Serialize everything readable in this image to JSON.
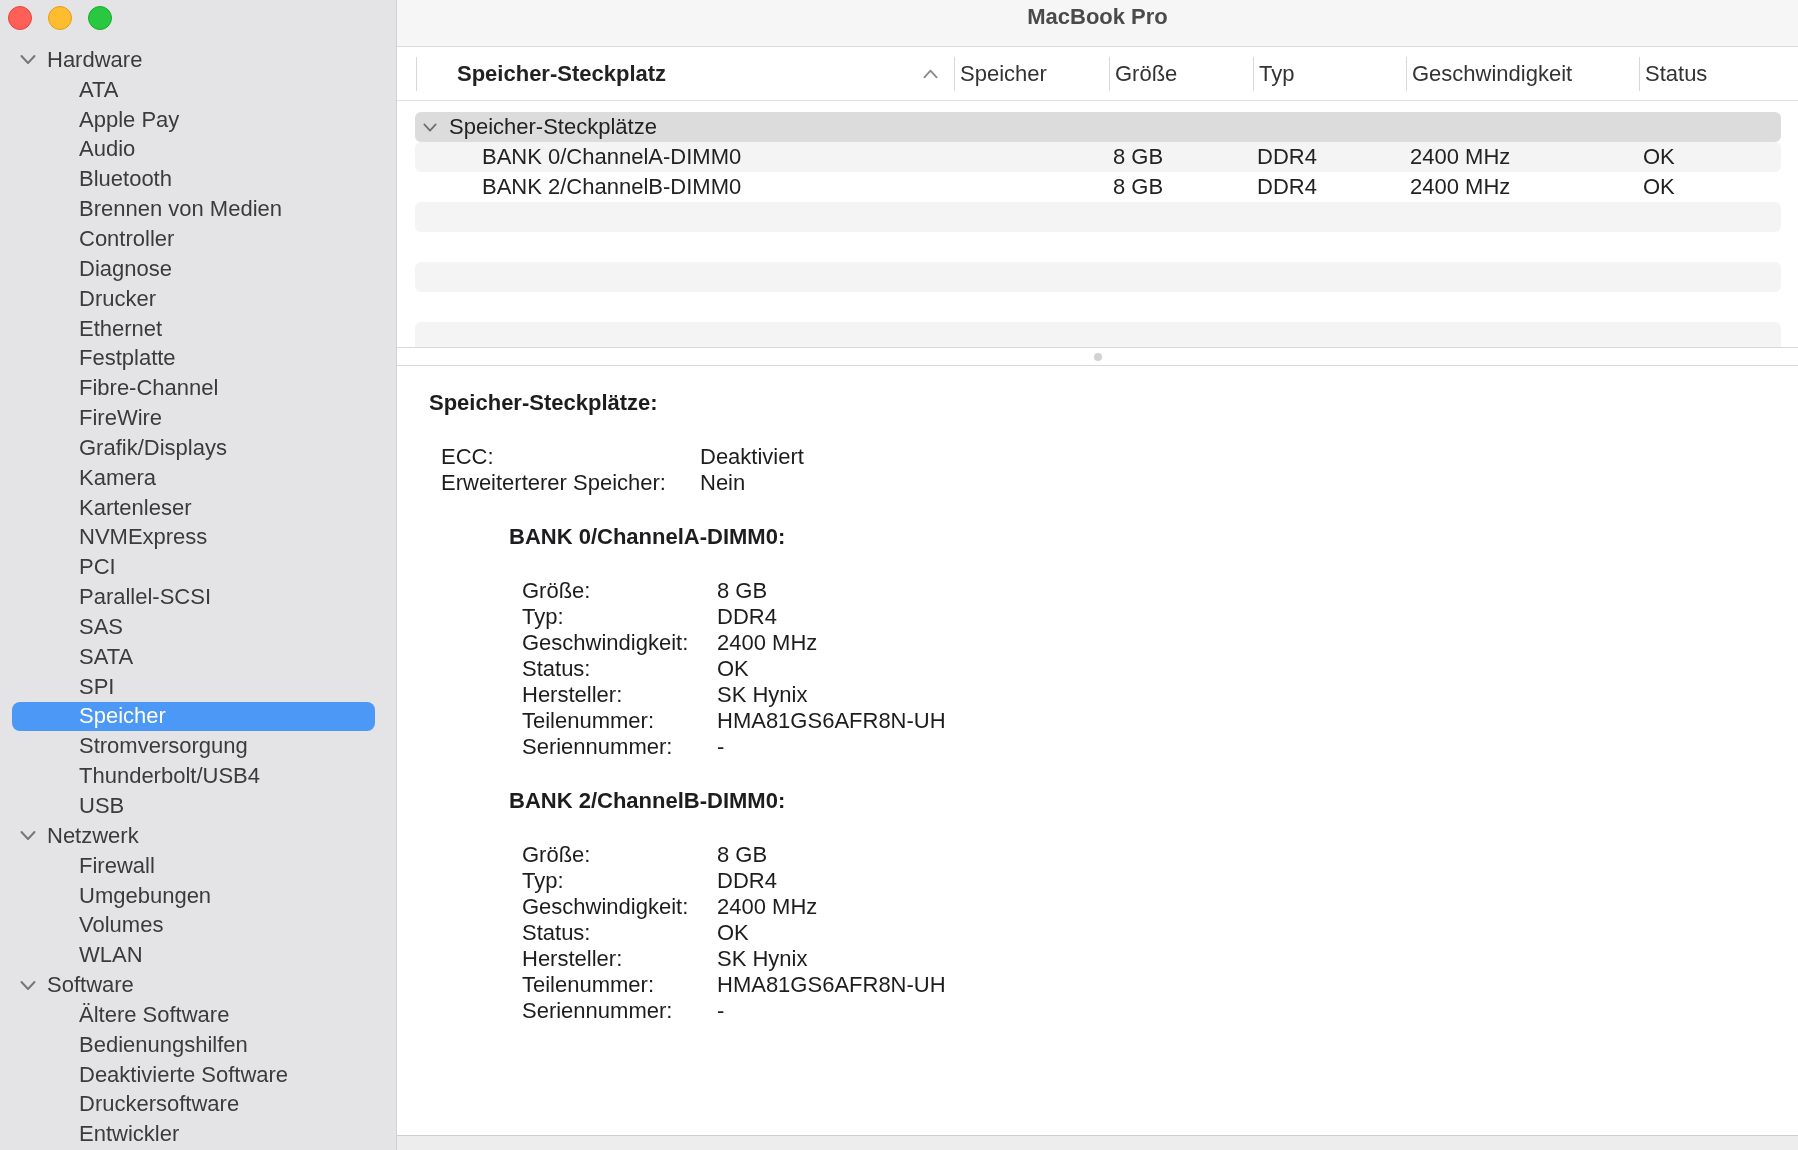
{
  "window": {
    "title": "MacBook Pro"
  },
  "sidebar": {
    "items": [
      {
        "label": "Hardware",
        "expanded": true,
        "selected": false,
        "children": [
          {
            "label": "ATA",
            "selected": false
          },
          {
            "label": "Apple Pay",
            "selected": false
          },
          {
            "label": "Audio",
            "selected": false
          },
          {
            "label": "Bluetooth",
            "selected": false
          },
          {
            "label": "Brennen von Medien",
            "selected": false
          },
          {
            "label": "Controller",
            "selected": false
          },
          {
            "label": "Diagnose",
            "selected": false
          },
          {
            "label": "Drucker",
            "selected": false
          },
          {
            "label": "Ethernet",
            "selected": false
          },
          {
            "label": "Festplatte",
            "selected": false
          },
          {
            "label": "Fibre-Channel",
            "selected": false
          },
          {
            "label": "FireWire",
            "selected": false
          },
          {
            "label": "Grafik/Displays",
            "selected": false
          },
          {
            "label": "Kamera",
            "selected": false
          },
          {
            "label": "Kartenleser",
            "selected": false
          },
          {
            "label": "NVMExpress",
            "selected": false
          },
          {
            "label": "PCI",
            "selected": false
          },
          {
            "label": "Parallel-SCSI",
            "selected": false
          },
          {
            "label": "SAS",
            "selected": false
          },
          {
            "label": "SATA",
            "selected": false
          },
          {
            "label": "SPI",
            "selected": false
          },
          {
            "label": "Speicher",
            "selected": true
          },
          {
            "label": "Stromversorgung",
            "selected": false
          },
          {
            "label": "Thunderbolt/USB4",
            "selected": false
          },
          {
            "label": "USB",
            "selected": false
          }
        ]
      },
      {
        "label": "Netzwerk",
        "expanded": true,
        "selected": false,
        "children": [
          {
            "label": "Firewall",
            "selected": false
          },
          {
            "label": "Umgebungen",
            "selected": false
          },
          {
            "label": "Volumes",
            "selected": false
          },
          {
            "label": "WLAN",
            "selected": false
          }
        ]
      },
      {
        "label": "Software",
        "expanded": true,
        "selected": false,
        "children": [
          {
            "label": "Ältere Software",
            "selected": false
          },
          {
            "label": "Bedienungshilfen",
            "selected": false
          },
          {
            "label": "Deaktivierte Software",
            "selected": false
          },
          {
            "label": "Druckersoftware",
            "selected": false
          },
          {
            "label": "Entwickler",
            "selected": false
          }
        ]
      }
    ]
  },
  "table": {
    "columns": [
      {
        "label": "Speicher-Steckplatz",
        "sorted": true
      },
      {
        "label": "Speicher",
        "sorted": false
      },
      {
        "label": "Größe",
        "sorted": false
      },
      {
        "label": "Typ",
        "sorted": false
      },
      {
        "label": "Geschwindigkeit",
        "sorted": false
      },
      {
        "label": "Status",
        "sorted": false
      }
    ],
    "rows": [
      {
        "slot": "Speicher-Steckplätze",
        "expanded": true,
        "selected": true,
        "children": [
          {
            "slot": "BANK 0/ChannelA-DIMM0",
            "size": "8 GB",
            "type": "DDR4",
            "speed": "2400 MHz",
            "status": "OK",
            "selected": false
          },
          {
            "slot": "BANK 2/ChannelB-DIMM0",
            "size": "8 GB",
            "type": "DDR4",
            "speed": "2400 MHz",
            "status": "OK",
            "selected": false
          }
        ]
      }
    ]
  },
  "detail": {
    "title": "Speicher-Steckplätze:",
    "properties": [
      {
        "label": "ECC:",
        "value": "Deaktiviert"
      },
      {
        "label": "Erweiterterer Speicher:",
        "value": "Nein"
      }
    ],
    "sections": [
      {
        "title": "BANK 0/ChannelA-DIMM0:",
        "properties": [
          {
            "label": "Größe:",
            "value": "8 GB"
          },
          {
            "label": "Typ:",
            "value": "DDR4"
          },
          {
            "label": "Geschwindigkeit:",
            "value": "2400 MHz"
          },
          {
            "label": "Status:",
            "value": "OK"
          },
          {
            "label": "Hersteller:",
            "value": "SK Hynix"
          },
          {
            "label": "Teilenummer:",
            "value": "HMA81GS6AFR8N-UH"
          },
          {
            "label": "Seriennummer:",
            "value": "-"
          }
        ]
      },
      {
        "title": "BANK 2/ChannelB-DIMM0:",
        "properties": [
          {
            "label": "Größe:",
            "value": "8 GB"
          },
          {
            "label": "Typ:",
            "value": "DDR4"
          },
          {
            "label": "Geschwindigkeit:",
            "value": "2400 MHz"
          },
          {
            "label": "Status:",
            "value": "OK"
          },
          {
            "label": "Hersteller:",
            "value": "SK Hynix"
          },
          {
            "label": "Teilenummer:",
            "value": "HMA81GS6AFR8N-UH"
          },
          {
            "label": "Seriennummer:",
            "value": "-"
          }
        ]
      }
    ]
  }
}
